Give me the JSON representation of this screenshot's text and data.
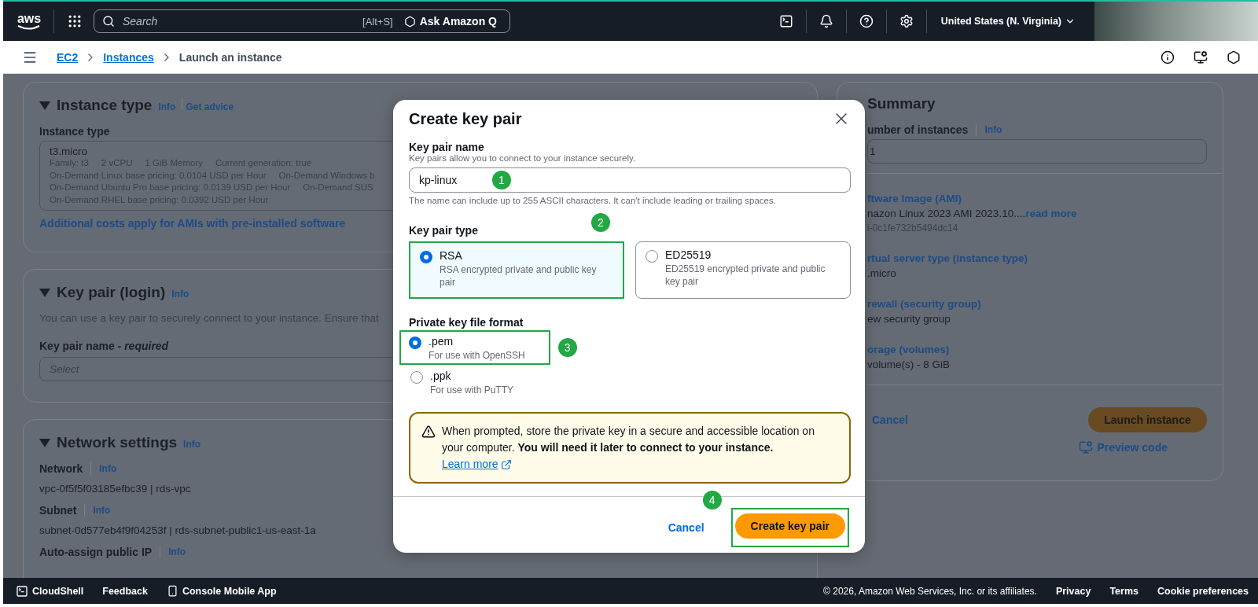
{
  "top_bar": {
    "logo": "aws",
    "search": {
      "placeholder": "Search",
      "shortcut": "[Alt+S]"
    },
    "ask_button": "Ask Amazon Q",
    "region": "United States (N. Virginia)"
  },
  "breadcrumbs": [
    {
      "label": "EC2",
      "link": true
    },
    {
      "label": "Instances",
      "link": true
    },
    {
      "label": "Launch an instance",
      "link": false
    }
  ],
  "instance_type_panel": {
    "title": "Instance type",
    "expanded": true,
    "info": "Info",
    "advice": "Get advice",
    "field_label": "Instance type",
    "selected_type": "t3.micro",
    "details": [
      [
        "Family: t3",
        "2 vCPU",
        "1 GiB Memory",
        "Current generation: true"
      ],
      [
        "On-Demand Linux base pricing: 0.0104 USD per Hour",
        "On-Demand Windows b"
      ],
      [
        "On-Demand Ubuntu Pro base pricing: 0.0139 USD per Hour",
        "On-Demand SUS"
      ],
      [
        "On-Demand RHEL base pricing: 0.0392 USD per Hour"
      ]
    ],
    "note_link": "Additional costs apply for AMIs with pre-installed software"
  },
  "key_pair_panel": {
    "title": "Key pair (login)",
    "expanded": true,
    "info": "Info",
    "description": "You can use a key pair to securely connect to your instance. Ensure that",
    "field_label": "Key pair name - *required*",
    "select_placeholder": "Select"
  },
  "network_panel": {
    "title": "Network settings",
    "expanded": true,
    "info": "Info",
    "fields": [
      {
        "label": "Network",
        "info": "Info",
        "value": "vpc-0f5f5f03185efbc39 | rds-vpc"
      },
      {
        "label": "Subnet",
        "info": "Info",
        "value": "subnet-0d577eb4f9f04253f | rds-subnet-public1-us-east-1a"
      },
      {
        "label": "Auto-assign public IP",
        "info": "Info"
      }
    ]
  },
  "summary": {
    "title": "Summary",
    "instances_label": "umber of instances",
    "info": "Info",
    "instances_value": "1",
    "items": [
      {
        "label": "ftware Image (AMI)",
        "value": "nazon Linux 2023 AMI 2023.10....",
        "value_link": "read more",
        "sub": "i-0c1fe732b5494dc14"
      },
      {
        "label": "rtual server type (instance type)",
        "value": ".micro"
      },
      {
        "label": "rewall (security group)",
        "value": "ew security group"
      },
      {
        "label": "orage (volumes)",
        "value": "volume(s) - 8 GiB"
      }
    ],
    "cancel": "Cancel",
    "launch": "Launch instance",
    "preview": "Preview code"
  },
  "modal": {
    "title": "Create key pair",
    "name_field": {
      "label": "Key pair name",
      "hint": "Key pairs allow you to connect to your instance securely.",
      "value": "kp-linux",
      "constraint": "The name can include up to 255 ASCII characters. It can't include leading or trailing spaces.",
      "callout": "1"
    },
    "type_group": {
      "label": "Key pair type",
      "options": [
        {
          "label": "RSA",
          "description": "RSA encrypted private and public key pair",
          "selected": true,
          "callout": "2"
        },
        {
          "label": "ED25519",
          "description": "ED25519 encrypted private and public key pair",
          "selected": false
        }
      ]
    },
    "format_group": {
      "label": "Private key file format",
      "options": [
        {
          "label": ".pem",
          "description": "For use with OpenSSH",
          "selected": true,
          "callout": "3"
        },
        {
          "label": ".ppk",
          "description": "For use with PuTTY",
          "selected": false
        }
      ]
    },
    "alert": {
      "text": "When prompted, store the private key in a secure and accessible location on your computer. **You will need it later to connect to your instance.**",
      "link": "Learn more"
    },
    "cancel": "Cancel",
    "create": {
      "label": "Create key pair",
      "callout": "4"
    }
  },
  "footer": {
    "cloudshell": "CloudShell",
    "feedback": "Feedback",
    "mobile_app": "Console Mobile App",
    "copyright": "© 2026, Amazon Web Services, Inc. or its affiliates.",
    "links": [
      "Privacy",
      "Terms",
      "Cookie preferences"
    ]
  }
}
